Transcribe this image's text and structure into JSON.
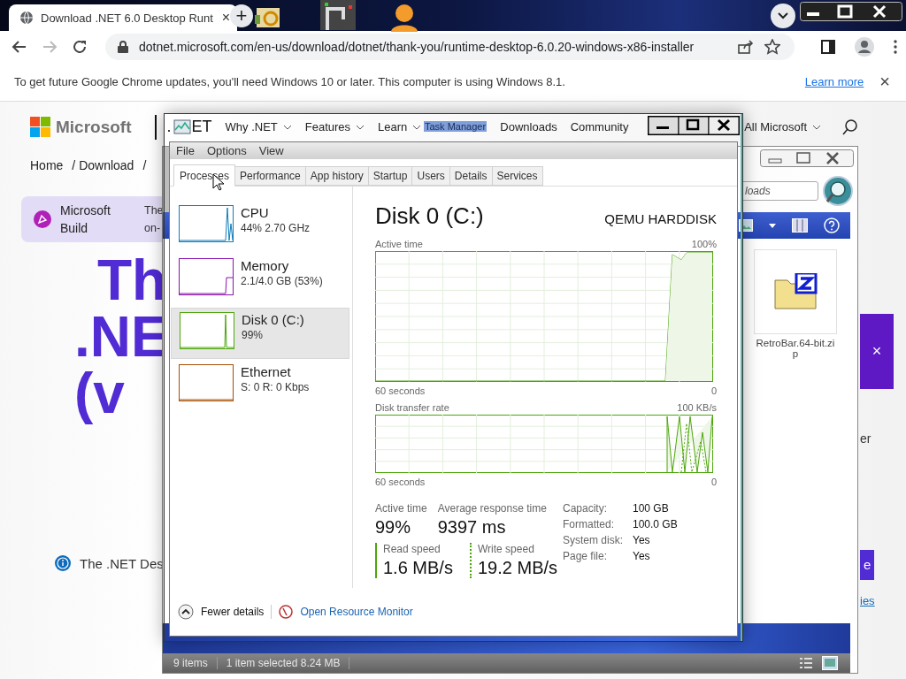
{
  "browser": {
    "tab": {
      "title": "Download .NET 6.0 Desktop Runt",
      "close": "×"
    },
    "new_tab": "+",
    "forward": {
      "disabled": true
    },
    "address": "dotnet.microsoft.com/en-us/download/dotnet/thank-you/runtime-desktop-6.0.20-windows-x86-installer"
  },
  "infobar": {
    "message": "To get future Google Chrome updates, you'll need Windows 10 or later. This computer is using Windows 8.1.",
    "link": "Learn more",
    "close": "×"
  },
  "site": {
    "brand": "Microsoft",
    "logo_left": ".",
    "logo_right": "ET",
    "nav": [
      {
        "label": "Why .NET",
        "dropdown": true
      },
      {
        "label": "Features",
        "dropdown": true
      },
      {
        "label": "Learn",
        "dropdown": true
      },
      {
        "label": "Downloads",
        "dropdown": false
      },
      {
        "label": "Community",
        "dropdown": false
      },
      {
        "label": "All Microsoft",
        "dropdown": true
      }
    ],
    "breadcrumb": [
      "Home",
      "/ Download",
      "/"
    ],
    "banner": {
      "title": "Microsoft Build",
      "lines": [
        "The",
        "on-"
      ]
    },
    "heading": [
      "Th",
      ".NE",
      "(v"
    ],
    "notice": "The .NET Des",
    "side_close": "×",
    "side_text": "er",
    "side_button": "e",
    "side_link": "ies"
  },
  "task_manager": {
    "title": "Task Manager",
    "menu": [
      "File",
      "Options",
      "View"
    ],
    "tabs": [
      {
        "label": "Processes",
        "selected": true
      },
      {
        "label": "Performance",
        "selected": false
      },
      {
        "label": "App history",
        "selected": false
      },
      {
        "label": "Startup",
        "selected": false
      },
      {
        "label": "Users",
        "selected": false
      },
      {
        "label": "Details",
        "selected": false
      },
      {
        "label": "Services",
        "selected": false
      }
    ],
    "resources": [
      {
        "kind": "cpu",
        "name": "CPU",
        "detail": "44% 2.70 GHz",
        "color": "#117dbb",
        "selected": false
      },
      {
        "kind": "memory",
        "name": "Memory",
        "detail": "2.1/4.0 GB (53%)",
        "color": "#8b12ae",
        "selected": false
      },
      {
        "kind": "disk",
        "name": "Disk 0 (C:)",
        "detail": "99%",
        "color": "#4da60c",
        "selected": true
      },
      {
        "kind": "network",
        "name": "Ethernet",
        "detail": "S: 0 R: 0 Kbps",
        "color": "#a74f01",
        "selected": false
      }
    ],
    "detail": {
      "title": "Disk 0 (C:)",
      "model": "QEMU HARDDISK",
      "charts": [
        {
          "kind": "active",
          "label": "Active time",
          "max": "100%",
          "span": "60 seconds",
          "min": "0"
        },
        {
          "kind": "transfer",
          "label": "Disk transfer rate",
          "max": "100 KB/s",
          "span": "60 seconds",
          "min": "0"
        }
      ],
      "stats": [
        {
          "label": "Active time",
          "value": "99%"
        },
        {
          "label": "Average response time",
          "value": "9397 ms"
        }
      ],
      "speeds": [
        {
          "kind": "read",
          "label": "Read speed",
          "value": "1.6 MB/s"
        },
        {
          "kind": "write",
          "label": "Write speed",
          "value": "19.2 MB/s"
        }
      ],
      "properties": [
        {
          "label": "Capacity:",
          "value": "100 GB"
        },
        {
          "label": "Formatted:",
          "value": "100.0 GB"
        },
        {
          "label": "System disk:",
          "value": "Yes"
        },
        {
          "label": "Page file:",
          "value": "Yes"
        }
      ]
    },
    "footer": {
      "toggle": "Fewer details",
      "link": "Open Resource Monitor"
    }
  },
  "explorer": {
    "search": "loads",
    "file": "RetroBar.64-bit.zip",
    "status": [
      "9 items",
      "1 item selected 8.24 MB"
    ]
  }
}
